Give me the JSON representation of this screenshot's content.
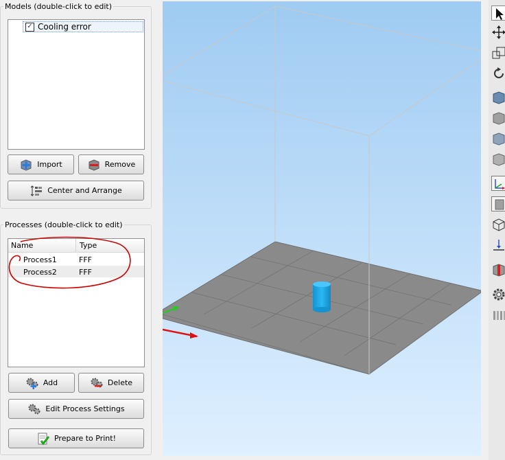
{
  "models": {
    "title": "Models (double-click to edit)",
    "items": [
      {
        "label": "Cooling error",
        "checked": true,
        "checkmark": "✓"
      }
    ],
    "import_label": "Import",
    "remove_label": "Remove",
    "center_label": "Center and Arrange"
  },
  "processes": {
    "title": "Processes (double-click to edit)",
    "columns": [
      "Name",
      "Type"
    ],
    "rows": [
      {
        "name": "Process1",
        "type": "FFF"
      },
      {
        "name": "Process2",
        "type": "FFF"
      }
    ],
    "add_label": "Add",
    "delete_label": "Delete",
    "edit_label": "Edit Process Settings",
    "prepare_label": "Prepare to Print!"
  },
  "colors": {
    "annotation": "#cc0000",
    "model_cylinder": "#1aa8e8",
    "bed": "#8c8c8c",
    "sky_top": "#9fcbf2",
    "x_axis": "#e01010",
    "y_axis": "#22cc22"
  },
  "toolbar_icons": [
    "select-arrow-icon",
    "move-icon",
    "scale-icon",
    "rotate-icon",
    "view-front-icon",
    "view-back-icon",
    "view-left-icon",
    "view-right-icon",
    "axes-icon",
    "solid-view-icon",
    "wireframe-view-icon",
    "place-on-bed-icon",
    "cut-icon",
    "settings-gear-icon",
    "supports-icon"
  ]
}
